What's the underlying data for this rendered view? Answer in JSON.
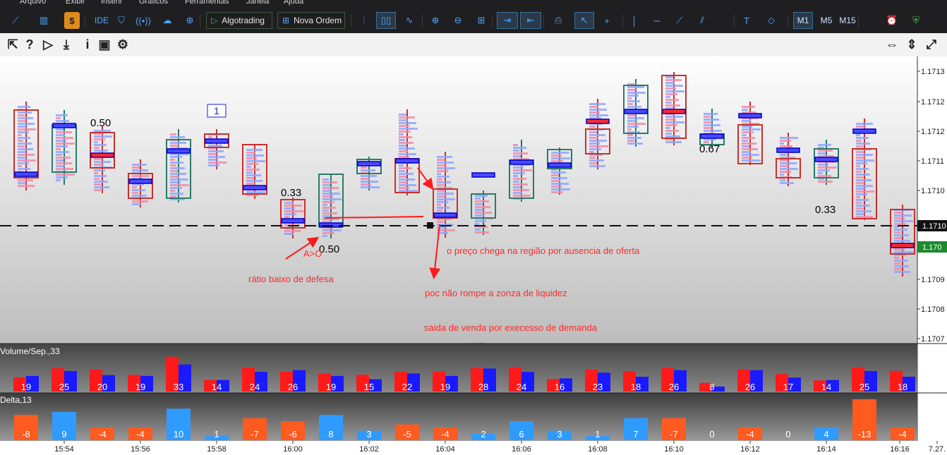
{
  "menu": [
    "Arquivo",
    "Exibir",
    "Inserir",
    "Gráficos",
    "Ferramentas",
    "Janela",
    "Ajuda"
  ],
  "toolbar": {
    "ide_label": "IDE",
    "algotrading_label": "Algotrading",
    "new_order_label": "Nova Ordem",
    "timeframes": [
      "M1",
      "M5",
      "M15"
    ],
    "icons": [
      "line-chart-icon",
      "chart-type-icon",
      "dollar-icon",
      "shopping-bag-icon",
      "signal-icon",
      "cloud-icon",
      "globe-icon",
      "play-icon",
      "plus-square-icon",
      "bars-icon",
      "candles-icon",
      "line-icon",
      "zoom-in-icon",
      "zoom-out-icon",
      "grid-icon",
      "autoscroll-icon",
      "chart-shift-icon",
      "screenshot-icon",
      "cursor-icon",
      "crosshair-icon",
      "vertical-line-icon",
      "horizontal-line-icon",
      "trendline-icon",
      "channel-icon",
      "text-icon",
      "shapes-icon",
      "alarm-icon",
      "shield-icon"
    ]
  },
  "secondary_toolbar": {
    "icons": [
      "arrow-tool-icon",
      "help-icon",
      "play-outline-icon",
      "download-icon",
      "info-icon",
      "chart-window-icon",
      "settings-icon",
      "resize-horizontal-icon",
      "resize-vertical-icon",
      "expand-icon"
    ]
  },
  "chart": {
    "price_labels": [
      "1.1713",
      "1.1712",
      "1.1712",
      "1.1711",
      "1.1710",
      "1.1710",
      "1.1709",
      "1.1708",
      "1.1707"
    ],
    "current_price": "1.1710",
    "bid_price": "1.170",
    "time_labels": [
      "15:54",
      "15:56",
      "15:58",
      "16:00",
      "16:02",
      "16:04",
      "16:06",
      "16:08",
      "16:10",
      "16:12",
      "16:14",
      "16:16",
      "7.27."
    ],
    "box_values": [
      "0.50",
      "0.33",
      "0.50",
      "0.67",
      "0.33"
    ],
    "box_count_label": "1",
    "annotations": [
      "A>O",
      "rátio baixo de defesa",
      "o preço chega na região por ausencia de oferta",
      "poc não rompe a zonza de liquidez",
      "saida de venda por execesso de demanda"
    ]
  },
  "volume_panel": {
    "label": "Volume/Sep.,33",
    "bars": [
      19,
      25,
      20,
      19,
      33,
      14,
      24,
      26,
      19,
      15,
      22,
      19,
      28,
      24,
      16,
      23,
      18,
      26,
      8,
      26,
      17,
      14,
      25,
      18
    ]
  },
  "delta_panel": {
    "label": "Delta,13",
    "values": [
      -8,
      9,
      -4,
      -4,
      10,
      1,
      -7,
      -6,
      8,
      3,
      -5,
      -4,
      2,
      6,
      3,
      1,
      7,
      -7,
      0,
      -4,
      0,
      4,
      -13,
      -4
    ]
  },
  "colors": {
    "red": "#ff1a1a",
    "blue": "#1a1aff",
    "delta_orange": "#ff5a1f",
    "delta_blue": "#2f9bff",
    "box_red": "#c8302d",
    "box_green": "#2b7a6b",
    "annot": "#ff2a2a"
  }
}
